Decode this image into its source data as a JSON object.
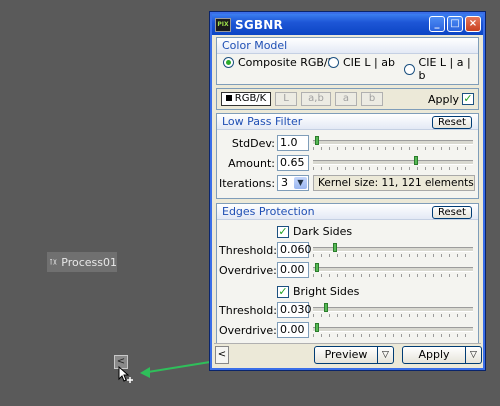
{
  "desktop": {
    "node_label": "Process01",
    "port_glyph": "<"
  },
  "window": {
    "title": "SGBNR",
    "app_icon_text": "PIX",
    "buttons": {
      "minimize": "_",
      "maximize": "□",
      "close": "×"
    }
  },
  "color_model": {
    "title": "Color Model",
    "options": [
      "Composite RGB/K",
      "CIE L | ab",
      "CIE L | a | b"
    ],
    "selected": "Composite RGB/K"
  },
  "channels": {
    "tabs": [
      "RGB/K",
      "L",
      "a,b",
      "a",
      "b"
    ],
    "active": "RGB/K",
    "apply_label": "Apply",
    "apply_checked": true
  },
  "low_pass": {
    "title": "Low Pass Filter",
    "reset_label": "Reset",
    "stddev_label": "StdDev:",
    "stddev_value": "1.0",
    "stddev_slider": 0.0,
    "amount_label": "Amount:",
    "amount_value": "0.65",
    "amount_slider": 0.65,
    "iterations_label": "Iterations:",
    "iterations_value": "3",
    "kernel_info": "Kernel size: 11, 121 elements"
  },
  "edges": {
    "title": "Edges Protection",
    "reset_label": "Reset",
    "dark_sides_label": "Dark Sides",
    "dark_checked": true,
    "dark_threshold_label": "Threshold:",
    "dark_threshold_value": "0.060",
    "dark_threshold_slider": 0.12,
    "dark_overdrive_label": "Overdrive:",
    "dark_overdrive_value": "0.00",
    "dark_overdrive_slider": 0.0,
    "bright_sides_label": "Bright Sides",
    "bright_checked": true,
    "bright_threshold_label": "Threshold:",
    "bright_threshold_value": "0.030",
    "bright_threshold_slider": 0.06,
    "bright_overdrive_label": "Overdrive:",
    "bright_overdrive_value": "0.00",
    "bright_overdrive_slider": 0.0
  },
  "bottom": {
    "port_glyph": "<",
    "preview_label": "Preview",
    "apply_label": "Apply",
    "drop_glyph": "▽"
  },
  "colors": {
    "link_line": "#2fbf5a",
    "title_bar": "#1d56d6",
    "group_title": "#1f4fb4"
  }
}
